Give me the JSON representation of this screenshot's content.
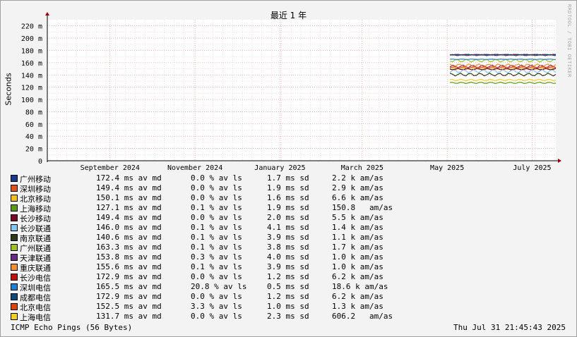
{
  "title": "最近 1 年",
  "watermark": "RRDTOOL / TOBI OETIKER",
  "footer": {
    "left": "ICMP Echo Pings (56 Bytes)",
    "right": "Thu Jul 31 21:45:43 2025"
  },
  "colors": {
    "background": "#f3f3f3",
    "plot_bg": "#ffffff",
    "grid_minor": "#e8c8c8",
    "grid_major": "#e08080",
    "axis_arrow": "#a00000"
  },
  "chart_data": {
    "type": "line",
    "title": "最近 1 年",
    "ylabel": "Seconds",
    "ylim": [
      0,
      230
    ],
    "yticks": [
      {
        "value": 0,
        "label": "0"
      },
      {
        "value": 20,
        "label": "20 m"
      },
      {
        "value": 40,
        "label": "40 m"
      },
      {
        "value": 60,
        "label": "60 m"
      },
      {
        "value": 80,
        "label": "80 m"
      },
      {
        "value": 100,
        "label": "100 m"
      },
      {
        "value": 120,
        "label": "120 m"
      },
      {
        "value": 140,
        "label": "140 m"
      },
      {
        "value": 160,
        "label": "160 m"
      },
      {
        "value": 180,
        "label": "180 m"
      },
      {
        "value": 200,
        "label": "200 m"
      },
      {
        "value": 220,
        "label": "220 m"
      }
    ],
    "xlim": [
      "2024-08-01",
      "2025-08-01"
    ],
    "xticks": [
      {
        "date": "2024-09-15",
        "label": "September 2024"
      },
      {
        "date": "2024-11-15",
        "label": "November 2024"
      },
      {
        "date": "2025-01-15",
        "label": "January 2025"
      },
      {
        "date": "2025-03-15",
        "label": "March 2025"
      },
      {
        "date": "2025-05-15",
        "label": "May 2025"
      },
      {
        "date": "2025-07-15",
        "label": "July 2025"
      }
    ],
    "grid": true,
    "legend_placement": "below",
    "data_start": "2025-05-17",
    "data_end": "2025-08-01",
    "series": [
      {
        "name": "广州移动",
        "color": "#1a3a8a",
        "avg": 172.4,
        "loss": "0.0 %",
        "sd": "1.7 ms",
        "amas": "2.2 k",
        "avg_text": "172.4 ms av md",
        "loss_text": "0.0 % av ls",
        "sd_text": "1.7 ms sd",
        "amas_text": "2.2 k am/as"
      },
      {
        "name": "深圳移动",
        "color": "#e0501a",
        "avg": 149.4,
        "loss": "0.0 %",
        "sd": "1.9 ms",
        "amas": "2.9 k",
        "avg_text": "149.4 ms av md",
        "loss_text": "0.0 % av ls",
        "sd_text": "1.9 ms sd",
        "amas_text": "2.9 k am/as"
      },
      {
        "name": "北京移动",
        "color": "#f0c020",
        "avg": 150.1,
        "loss": "0.0 %",
        "sd": "1.6 ms",
        "amas": "6.6 k",
        "avg_text": "150.1 ms av md",
        "loss_text": "0.0 % av ls",
        "sd_text": "1.6 ms sd",
        "amas_text": "6.6 k am/as"
      },
      {
        "name": "上海移动",
        "color": "#5a9a1a",
        "avg": 127.1,
        "loss": "0.1 %",
        "sd": "1.9 ms",
        "amas": "150.8",
        "avg_text": "127.1 ms av md",
        "loss_text": "0.1 % av ls",
        "sd_text": "1.9 ms sd",
        "amas_text": "150.8   am/as"
      },
      {
        "name": "长沙移动",
        "color": "#7a0a2a",
        "avg": 149.4,
        "loss": "0.0 %",
        "sd": "2.0 ms",
        "amas": "5.5 k",
        "avg_text": "149.4 ms av md",
        "loss_text": "0.0 % av ls",
        "sd_text": "2.0 ms sd",
        "amas_text": "5.5 k am/as"
      },
      {
        "name": "长沙联通",
        "color": "#80c8f0",
        "avg": 146.0,
        "loss": "0.1 %",
        "sd": "4.1 ms",
        "amas": "1.4 k",
        "avg_text": "146.0 ms av md",
        "loss_text": "0.1 % av ls",
        "sd_text": "4.1 ms sd",
        "amas_text": "1.4 k am/as"
      },
      {
        "name": "南京联通",
        "color": "#303a1a",
        "avg": 140.6,
        "loss": "0.1 %",
        "sd": "3.9 ms",
        "amas": "1.1 k",
        "avg_text": "140.6 ms av md",
        "loss_text": "0.1 % av ls",
        "sd_text": "3.9 ms sd",
        "amas_text": "1.1 k am/as"
      },
      {
        "name": "广州联通",
        "color": "#a0c020",
        "avg": 163.3,
        "loss": "0.1 %",
        "sd": "3.8 ms",
        "amas": "1.7 k",
        "avg_text": "163.3 ms av md",
        "loss_text": "0.1 % av ls",
        "sd_text": "3.8 ms sd",
        "amas_text": "1.7 k am/as"
      },
      {
        "name": "天津联通",
        "color": "#6a2a8a",
        "avg": 153.8,
        "loss": "0.3 %",
        "sd": "4.0 ms",
        "amas": "1.0 k",
        "avg_text": "153.8 ms av md",
        "loss_text": "0.3 % av ls",
        "sd_text": "4.0 ms sd",
        "amas_text": "1.0 k am/as"
      },
      {
        "name": "重庆联通",
        "color": "#f09030",
        "avg": 155.6,
        "loss": "0.1 %",
        "sd": "3.9 ms",
        "amas": "1.0 k",
        "avg_text": "155.6 ms av md",
        "loss_text": "0.1 % av ls",
        "sd_text": "3.9 ms sd",
        "amas_text": "1.0 k am/as"
      },
      {
        "name": "长沙电信",
        "color": "#c01010",
        "avg": 172.9,
        "loss": "0.0 %",
        "sd": "1.2 ms",
        "amas": "6.2 k",
        "avg_text": "172.9 ms av md",
        "loss_text": "0.0 % av ls",
        "sd_text": "1.2 ms sd",
        "amas_text": "6.2 k am/as"
      },
      {
        "name": "深圳电信",
        "color": "#2080d0",
        "avg": 165.5,
        "loss": "20.8 %",
        "sd": "0.5 ms",
        "amas": "18.6 k",
        "avg_text": "165.5 ms av md",
        "loss_text": "20.8 % av ls",
        "sd_text": "0.5 ms sd",
        "amas_text": "18.6 k am/as"
      },
      {
        "name": "成都电信",
        "color": "#104a7a",
        "avg": 172.9,
        "loss": "0.0 %",
        "sd": "1.2 ms",
        "amas": "6.2 k",
        "avg_text": "172.9 ms av md",
        "loss_text": "0.0 % av ls",
        "sd_text": "1.2 ms sd",
        "amas_text": "6.2 k am/as"
      },
      {
        "name": "北京电信",
        "color": "#e04010",
        "avg": 152.5,
        "loss": "3.3 %",
        "sd": "1.0 ms",
        "amas": "1.3 k",
        "avg_text": "152.5 ms av md",
        "loss_text": "3.3 % av ls",
        "sd_text": "1.0 ms sd",
        "amas_text": "1.3 k am/as"
      },
      {
        "name": "上海电信",
        "color": "#f0d020",
        "avg": 131.7,
        "loss": "0.0 %",
        "sd": "2.3 ms",
        "amas": "606.2",
        "avg_text": "131.7 ms av md",
        "loss_text": "0.0 % av ls",
        "sd_text": "2.3 ms sd",
        "amas_text": "606.2   am/as"
      }
    ]
  }
}
